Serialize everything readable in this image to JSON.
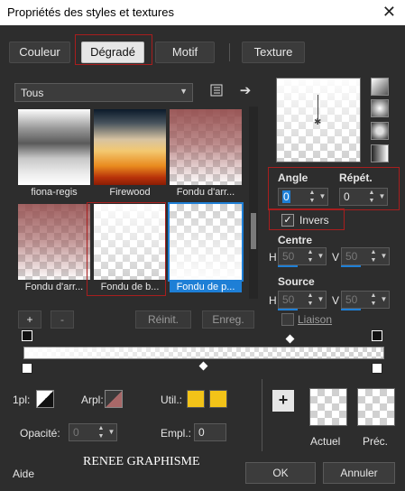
{
  "window": {
    "title": "Propriétés des styles et textures",
    "close_icon": "close-icon"
  },
  "tabs": [
    {
      "label": "Couleur"
    },
    {
      "label": "Dégradé"
    },
    {
      "label": "Motif"
    },
    {
      "label": "Texture"
    }
  ],
  "library": {
    "filter_value": "Tous",
    "gradients": [
      {
        "caption": "fiona-regis"
      },
      {
        "caption": "Firewood"
      },
      {
        "caption": "Fondu d'arr..."
      },
      {
        "caption": "Fondu d'arr..."
      },
      {
        "caption": "Fondu de b..."
      },
      {
        "caption": "Fondu de p..."
      }
    ],
    "add_label": "+",
    "remove_label": "-",
    "reset_label": "Réinit.",
    "save_label": "Enreg."
  },
  "settings": {
    "angle_label": "Angle",
    "angle_value": "0",
    "repeat_label": "Répét.",
    "repeat_value": "0",
    "invert_label": "Invers",
    "invert_checked": true,
    "center_label": "Centre",
    "center_h_label": "H",
    "center_h": "50",
    "center_v_label": "V",
    "center_v": "50",
    "source_label": "Source",
    "source_h_label": "H",
    "source_h": "50",
    "source_v_label": "V",
    "source_v": "50",
    "link_label": "Liaison"
  },
  "editor": {
    "opaque_label": "1pl:",
    "background_label": "Arpl:",
    "util_label": "Util.:",
    "util_color": "#f2c318",
    "opacity_label": "Opacité:",
    "opacity_value": "0",
    "location_label": "Empl.:",
    "location_value": "0"
  },
  "compare": {
    "current_label": "Actuel",
    "previous_label": "Préc."
  },
  "footer": {
    "help_label": "Aide",
    "watermark": "RENEE GRAPHISME",
    "ok_label": "OK",
    "cancel_label": "Annuler"
  },
  "colors": {
    "accent": "#1e7fd6",
    "highlight": "#a81e1e"
  }
}
